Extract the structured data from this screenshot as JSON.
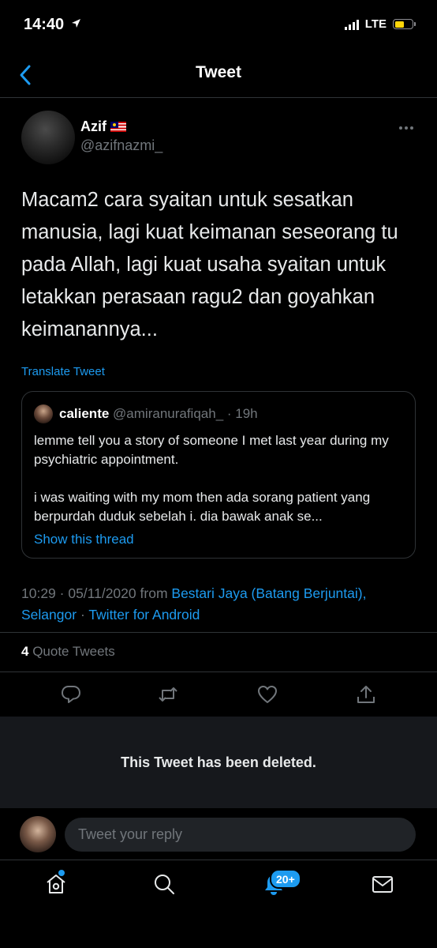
{
  "status_bar": {
    "time": "14:40",
    "network": "LTE",
    "battery_level": 0.55,
    "battery_color": "#ffd60a"
  },
  "nav": {
    "title": "Tweet",
    "back_icon": "chevron-left-icon"
  },
  "tweet": {
    "author_name": "Azif",
    "author_flag": "malaysia-flag-icon",
    "author_handle": "@azifnazmi_",
    "text": "Macam2 cara syaitan untuk sesatkan manusia, lagi kuat keimanan seseorang tu pada Allah, lagi kuat usaha syaitan untuk letakkan perasaan ragu2 dan goyahkan keimanannya...",
    "translate_label": "Translate Tweet",
    "timestamp": "10:29 · 05/11/2020",
    "from_label": "from",
    "location": "Bestari Jaya (Batang Berjuntai), Selangor",
    "separator": "·",
    "client": "Twitter for Android",
    "quote_count": "4",
    "quote_label": "Quote Tweets"
  },
  "quoted": {
    "name": "caliente",
    "handle": "@amiranurafiqah_",
    "time": "· 19h",
    "text_1": "lemme tell you a story of someone I met last year during my psychiatric appointment.",
    "text_2": "i was waiting with my mom then ada sorang patient yang berpurdah duduk sebelah i. dia bawak anak se...",
    "thread_link": "Show this thread"
  },
  "actions": [
    "reply-icon",
    "retweet-icon",
    "like-icon",
    "share-icon"
  ],
  "deleted_notice": "This Tweet has been deleted.",
  "reply": {
    "placeholder": "Tweet your reply"
  },
  "tab_bar": {
    "items": [
      "home-icon",
      "search-icon",
      "notifications-icon",
      "messages-icon"
    ],
    "notifications_badge": "20+"
  },
  "colors": {
    "accent": "#1d9bf0",
    "muted": "#71767b",
    "background": "#000000"
  }
}
